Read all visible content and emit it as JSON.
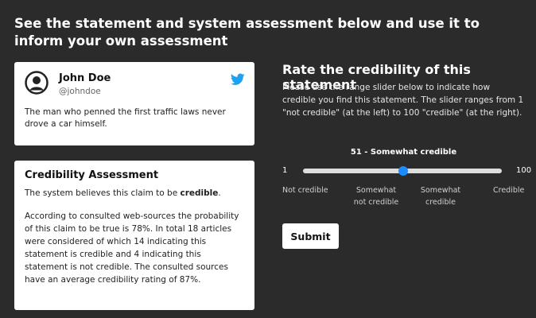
{
  "header": {
    "title": "See the statement and system assessment below and use it to inform your own assessment"
  },
  "tweet": {
    "name": "John Doe",
    "handle": "@johndoe",
    "text": "The man who penned the first traffic laws never drove a car himself.",
    "brand_color": "#1da1f2"
  },
  "assessment": {
    "title": "Credibility Assessment",
    "verdict_prefix": "The system believes this claim to be ",
    "verdict": "credible",
    "verdict_suffix": ".",
    "body": "According to consulted web-sources the probability of this claim to be true is 78%. In total 18 articles were considered of which 14 indicating this statement is credible and 4 indicating this statement is not credible. The consulted sources have an average credibility rating of 87%."
  },
  "rating": {
    "title": "Rate the credibility of this statement",
    "description": "Please use the range slider below to indicate how credible you find this statement. The slider ranges from 1 \"not credible\" (at the left) to 100 \"credible\" (at the right).",
    "value_label": "51 - Somewhat credible",
    "value": 51,
    "min": 1,
    "max": 100,
    "min_label": "1",
    "max_label": "100",
    "ticks": [
      "Not credible",
      "Somewhat\nnot credible",
      "Somewhat\ncredible",
      "Credible"
    ],
    "accent": "#1a8cff"
  },
  "submit_label": "Submit"
}
